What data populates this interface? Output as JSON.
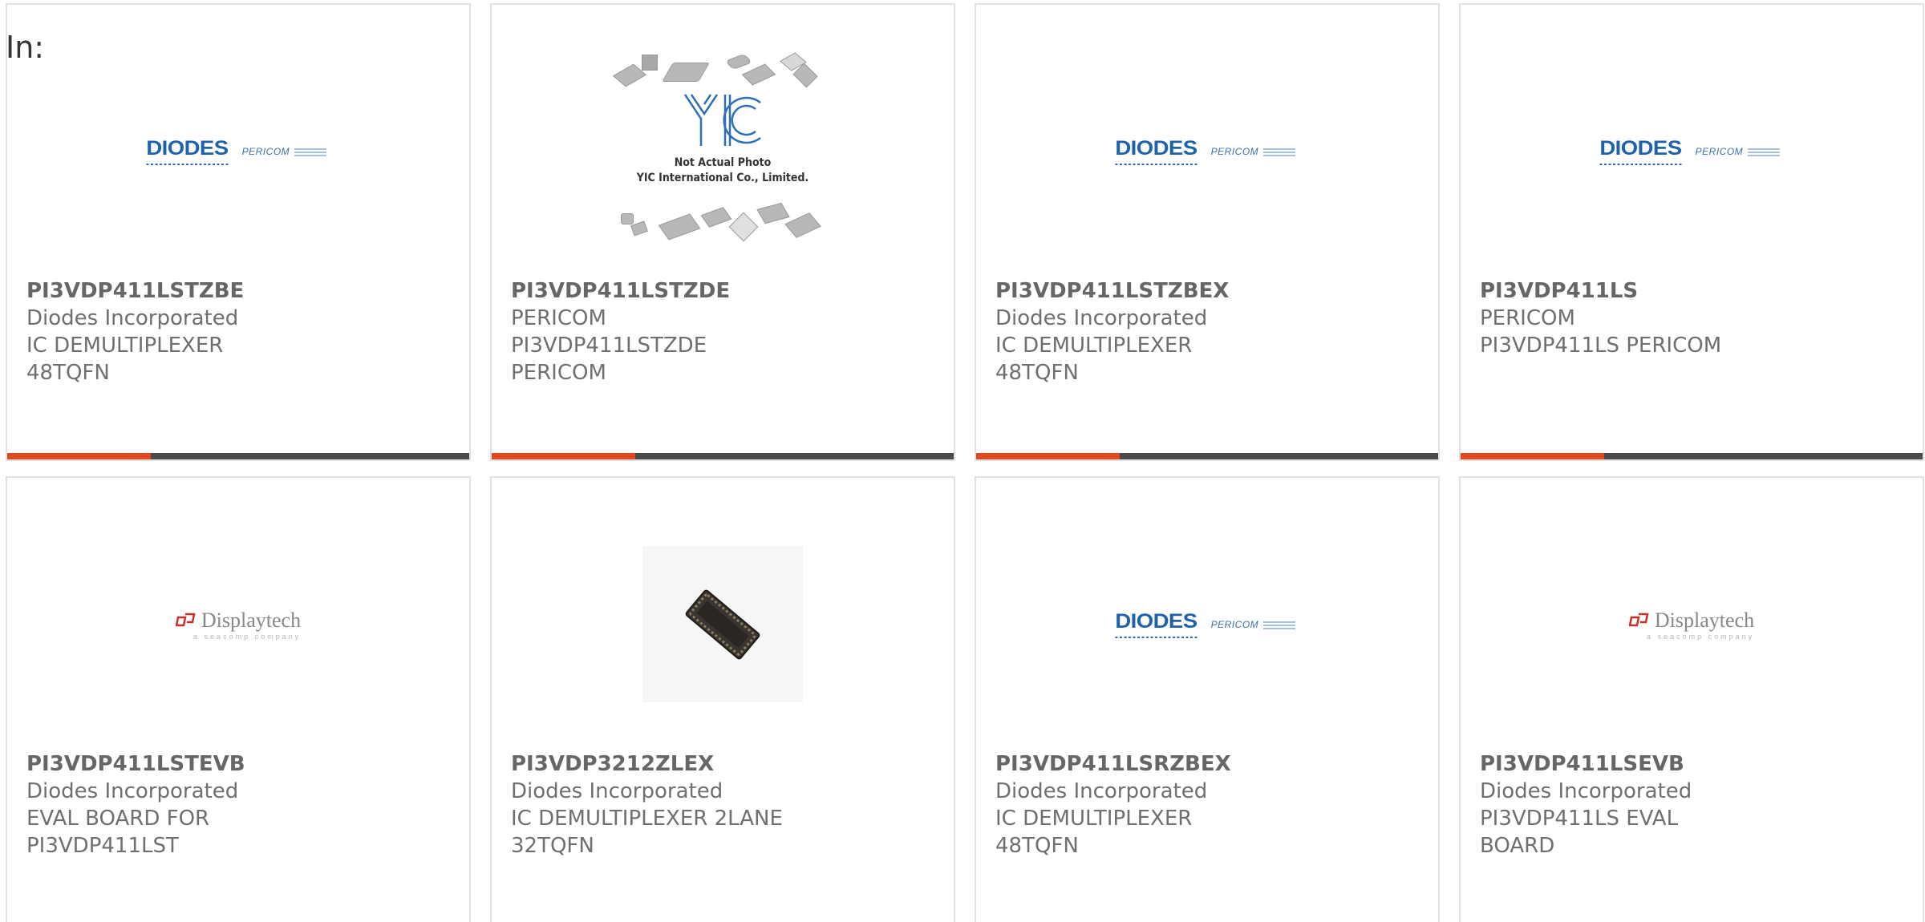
{
  "filter": {
    "label": "In:"
  },
  "colors": {
    "accent": "#e4461f",
    "bar": "#4a4a4a",
    "diodes_blue": "#1f62ac",
    "pericom_blue": "#3c6ea8",
    "displaytech_red": "#c9302c"
  },
  "logos": {
    "diodes": {
      "brand": "DIODES",
      "partner": "PERICOM"
    },
    "displaytech": {
      "brand": "Displaytech",
      "tagline": "a seacomp company"
    },
    "yic": {
      "mark": "YIC",
      "caption_line1": "Not Actual Photo",
      "caption_line2": "YIC International Co., Limited."
    }
  },
  "products": [
    {
      "part_number": "PI3VDP411LSTZBE",
      "manufacturer": "Diodes Incorporated",
      "description": "IC DEMULTIPLEXER 48TQFN",
      "image": "diodes-pericom-logo",
      "progress": 0.31
    },
    {
      "part_number": "PI3VDP411LSTZDE",
      "manufacturer": "PERICOM",
      "description": "PI3VDP411LSTZDE PERICOM",
      "image": "yic-placeholder",
      "progress": 0.31
    },
    {
      "part_number": "PI3VDP411LSTZBEX",
      "manufacturer": "Diodes Incorporated",
      "description": "IC DEMULTIPLEXER 48TQFN",
      "image": "diodes-pericom-logo",
      "progress": 0.31
    },
    {
      "part_number": "PI3VDP411LS",
      "manufacturer": "PERICOM",
      "description": "PI3VDP411LS PERICOM",
      "image": "diodes-pericom-logo",
      "progress": 0.31
    },
    {
      "part_number": "PI3VDP411LSTEVB",
      "manufacturer": "Diodes Incorporated",
      "description": "EVAL BOARD FOR PI3VDP411LST",
      "image": "displaytech-logo"
    },
    {
      "part_number": "PI3VDP3212ZLEX",
      "manufacturer": "Diodes Incorporated",
      "description": "IC DEMULTIPLEXER 2LANE 32TQFN",
      "image": "tqfn-chip-photo"
    },
    {
      "part_number": "PI3VDP411LSRZBEX",
      "manufacturer": "Diodes Incorporated",
      "description": "IC DEMULTIPLEXER 48TQFN",
      "image": "diodes-pericom-logo"
    },
    {
      "part_number": "PI3VDP411LSEVB",
      "manufacturer": "Diodes Incorporated",
      "description": "PI3VDP411LS EVAL BOARD",
      "image": "displaytech-logo"
    }
  ]
}
